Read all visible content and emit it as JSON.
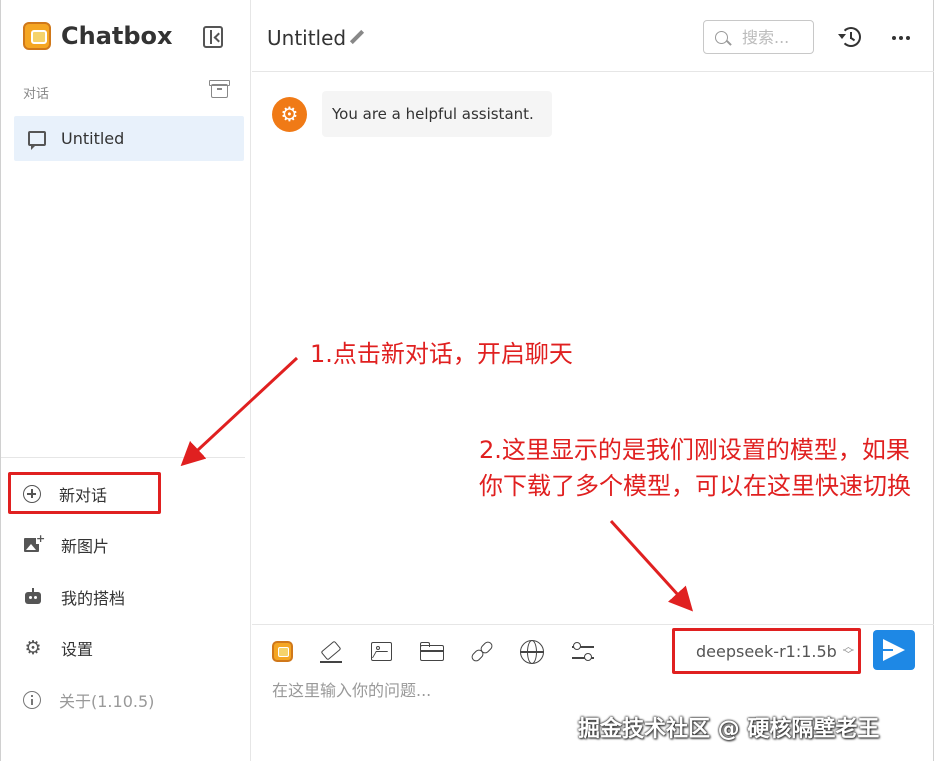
{
  "app": {
    "brand_name": "Chatbox",
    "accent_color": "#1e88e5",
    "brand_color": "#f5a623"
  },
  "sidebar": {
    "section_label": "对话",
    "conversations": [
      {
        "label": "Untitled",
        "icon": "chat-bubble-icon",
        "selected": true
      }
    ],
    "nav": {
      "new_chat": "新对话",
      "new_image": "新图片",
      "my_copilots": "我的搭档",
      "settings": "设置",
      "about": "关于(1.10.5)"
    }
  },
  "header": {
    "title": "Untitled",
    "search_placeholder": "搜索..."
  },
  "messages": [
    {
      "role": "system",
      "text": "You are a helpful assistant."
    }
  ],
  "composer": {
    "model": "deepseek-r1:1.5b",
    "placeholder": "在这里输入你的问题..."
  },
  "annotations": {
    "note_1": "1.点击新对话，开启聊天",
    "note_2": "2.这里显示的是我们刚设置的模型，如果你下载了多个模型，可以在这里快速切换",
    "color": "#e02020"
  },
  "watermark": "掘金技术社区 @ 硬核隔壁老王"
}
